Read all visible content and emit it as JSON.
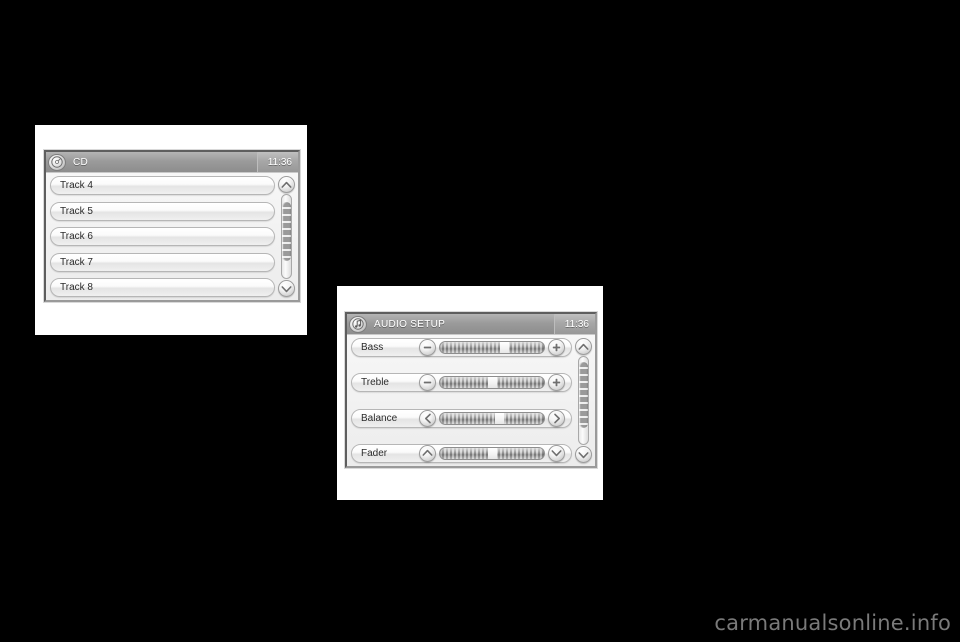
{
  "page": {
    "background_color": "#000000",
    "watermark": "carmanualsonline.info",
    "watermark_color": "#7a7a7a"
  },
  "figures": [
    {
      "name": "cd-track-list-screen",
      "plate_color": "#ffffff",
      "screen": {
        "titlebar": {
          "icon": "cd-disc-icon",
          "title": "CD",
          "clock": "11:36",
          "bar_color": "#979797",
          "text_color": "#ffffff"
        },
        "list_items": [
          {
            "label": "Track 4"
          },
          {
            "label": "Track 5"
          },
          {
            "label": "Track 6"
          },
          {
            "label": "Track 7"
          },
          {
            "label": "Track 8"
          }
        ],
        "scrollbar": {
          "up_icon": "chevron-up-icon",
          "down_icon": "chevron-down-icon",
          "thumb_top_percent": 8,
          "thumb_height_percent": 72
        }
      }
    },
    {
      "name": "audio-setup-screen",
      "plate_color": "#ffffff",
      "screen": {
        "titlebar": {
          "icon": "audio-note-icon",
          "title": "AUDIO SETUP",
          "clock": "11:36",
          "bar_color": "#979797",
          "text_color": "#ffffff"
        },
        "settings": [
          {
            "label": "Bass",
            "left_icon": "minus-icon",
            "right_icon": "plus-icon",
            "marker_percent": 62
          },
          {
            "label": "Treble",
            "left_icon": "minus-icon",
            "right_icon": "plus-icon",
            "marker_percent": 50
          },
          {
            "label": "Balance",
            "left_icon": "chevron-left-icon",
            "right_icon": "chevron-right-icon",
            "marker_percent": 57
          },
          {
            "label": "Fader",
            "left_icon": "chevron-up-icon",
            "right_icon": "chevron-down-icon",
            "marker_percent": 50
          }
        ],
        "scrollbar": {
          "up_icon": "chevron-up-icon",
          "down_icon": "chevron-down-icon",
          "thumb_top_percent": 6,
          "thumb_height_percent": 76
        }
      }
    }
  ]
}
